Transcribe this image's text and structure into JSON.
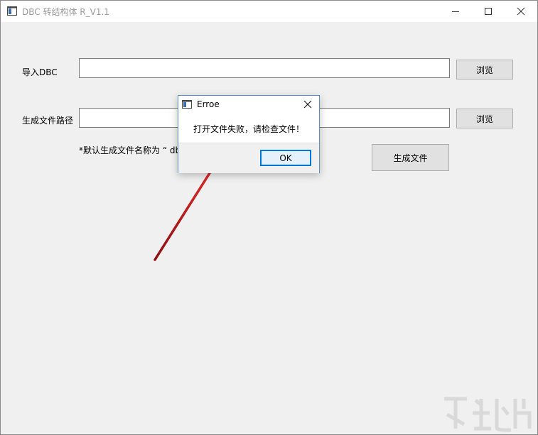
{
  "window": {
    "title": "DBC 转结构体 R_V1.1"
  },
  "form": {
    "import_label": "导入DBC",
    "import_value": "",
    "browse1_label": "浏览",
    "output_label": "生成文件路径",
    "output_value": "",
    "browse2_label": "浏览",
    "hint_text": "*默认生成文件名称为 “ db",
    "generate_label": "生成文件"
  },
  "dialog": {
    "title": "Erroe",
    "message": "打开文件失败，请检查文件！",
    "ok_label": "OK"
  },
  "colors": {
    "accent": "#0078d7",
    "arrow": "#c8181c"
  },
  "icons": {
    "app": "app-window-icon",
    "minimize": "minimize-icon",
    "maximize": "maximize-icon",
    "close": "close-icon",
    "dialog_close": "close-icon",
    "annotation": "red-arrow-icon"
  }
}
